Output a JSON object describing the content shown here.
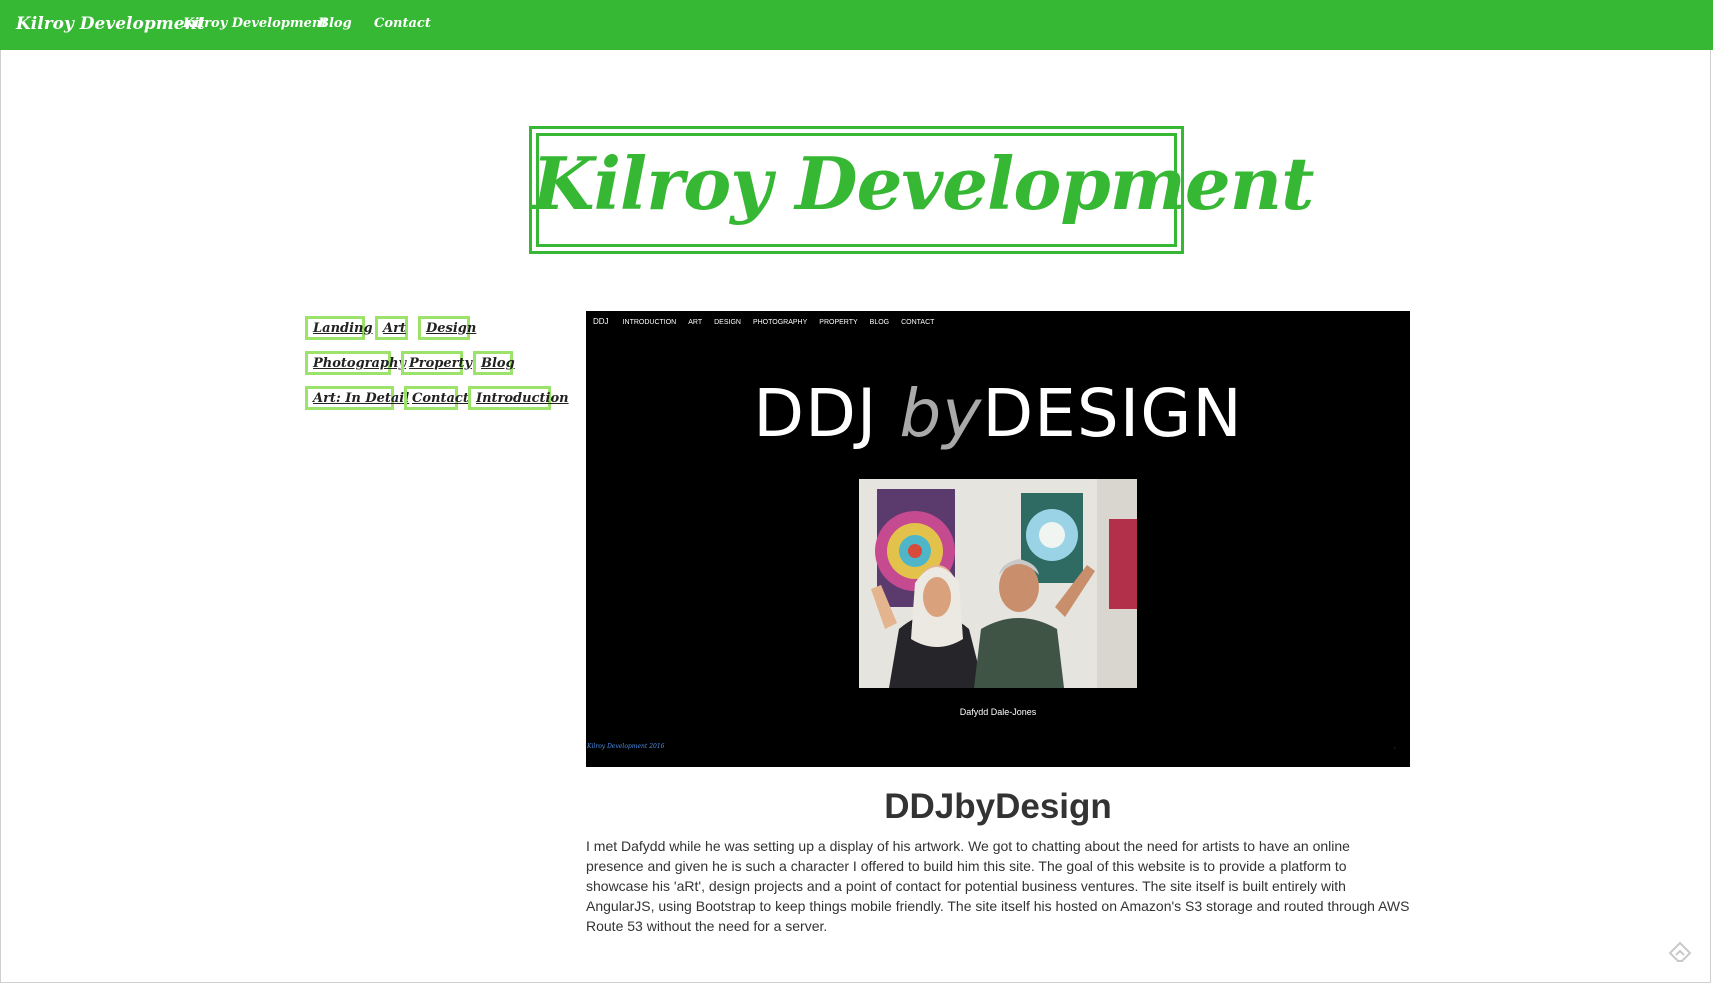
{
  "navbar": {
    "brand": "Kilroy Development",
    "links": [
      "Kilroy Development",
      "Blog",
      "Contact"
    ],
    "color": "#37b834"
  },
  "logo": {
    "text": "Kilroy Development"
  },
  "sidebar": {
    "tags": [
      {
        "label": "Landing"
      },
      {
        "label": "Art"
      },
      {
        "label": "Design"
      },
      {
        "label": "Photography"
      },
      {
        "label": "Property"
      },
      {
        "label": "Blog"
      },
      {
        "label": "Art: In Detail"
      },
      {
        "label": "Contact"
      },
      {
        "label": "Introduction"
      }
    ],
    "border_color": "#9be36a"
  },
  "preview": {
    "nav_brand": "DDJ",
    "nav_items": [
      "INTRODUCTION",
      "ART",
      "DESIGN",
      "PHOTOGRAPHY",
      "PROPERTY",
      "BLOG",
      "CONTACT"
    ],
    "title_left": "DDJ",
    "title_by": "by",
    "title_right": "DESIGN",
    "caption": "Dafydd Dale-Jones",
    "footer": "Kilroy Development 2016",
    "arrow": "‹"
  },
  "article": {
    "title": "DDJbyDesign",
    "body": "I met Dafydd while he was setting up a display of his artwork. We got to chatting about the need for artists to have an online presence and given he is such a character I offered to build him this site. The goal of this website is to provide a platform to showcase his 'aRt', design projects and a point of contact for potential business ventures. The site itself is built entirely with AngularJS, using Bootstrap to keep things mobile friendly. The site itself his hosted on Amazon's S3 storage and routed through AWS Route 53 without the need for a server."
  },
  "icons": {
    "corner": "feedly-icon"
  }
}
